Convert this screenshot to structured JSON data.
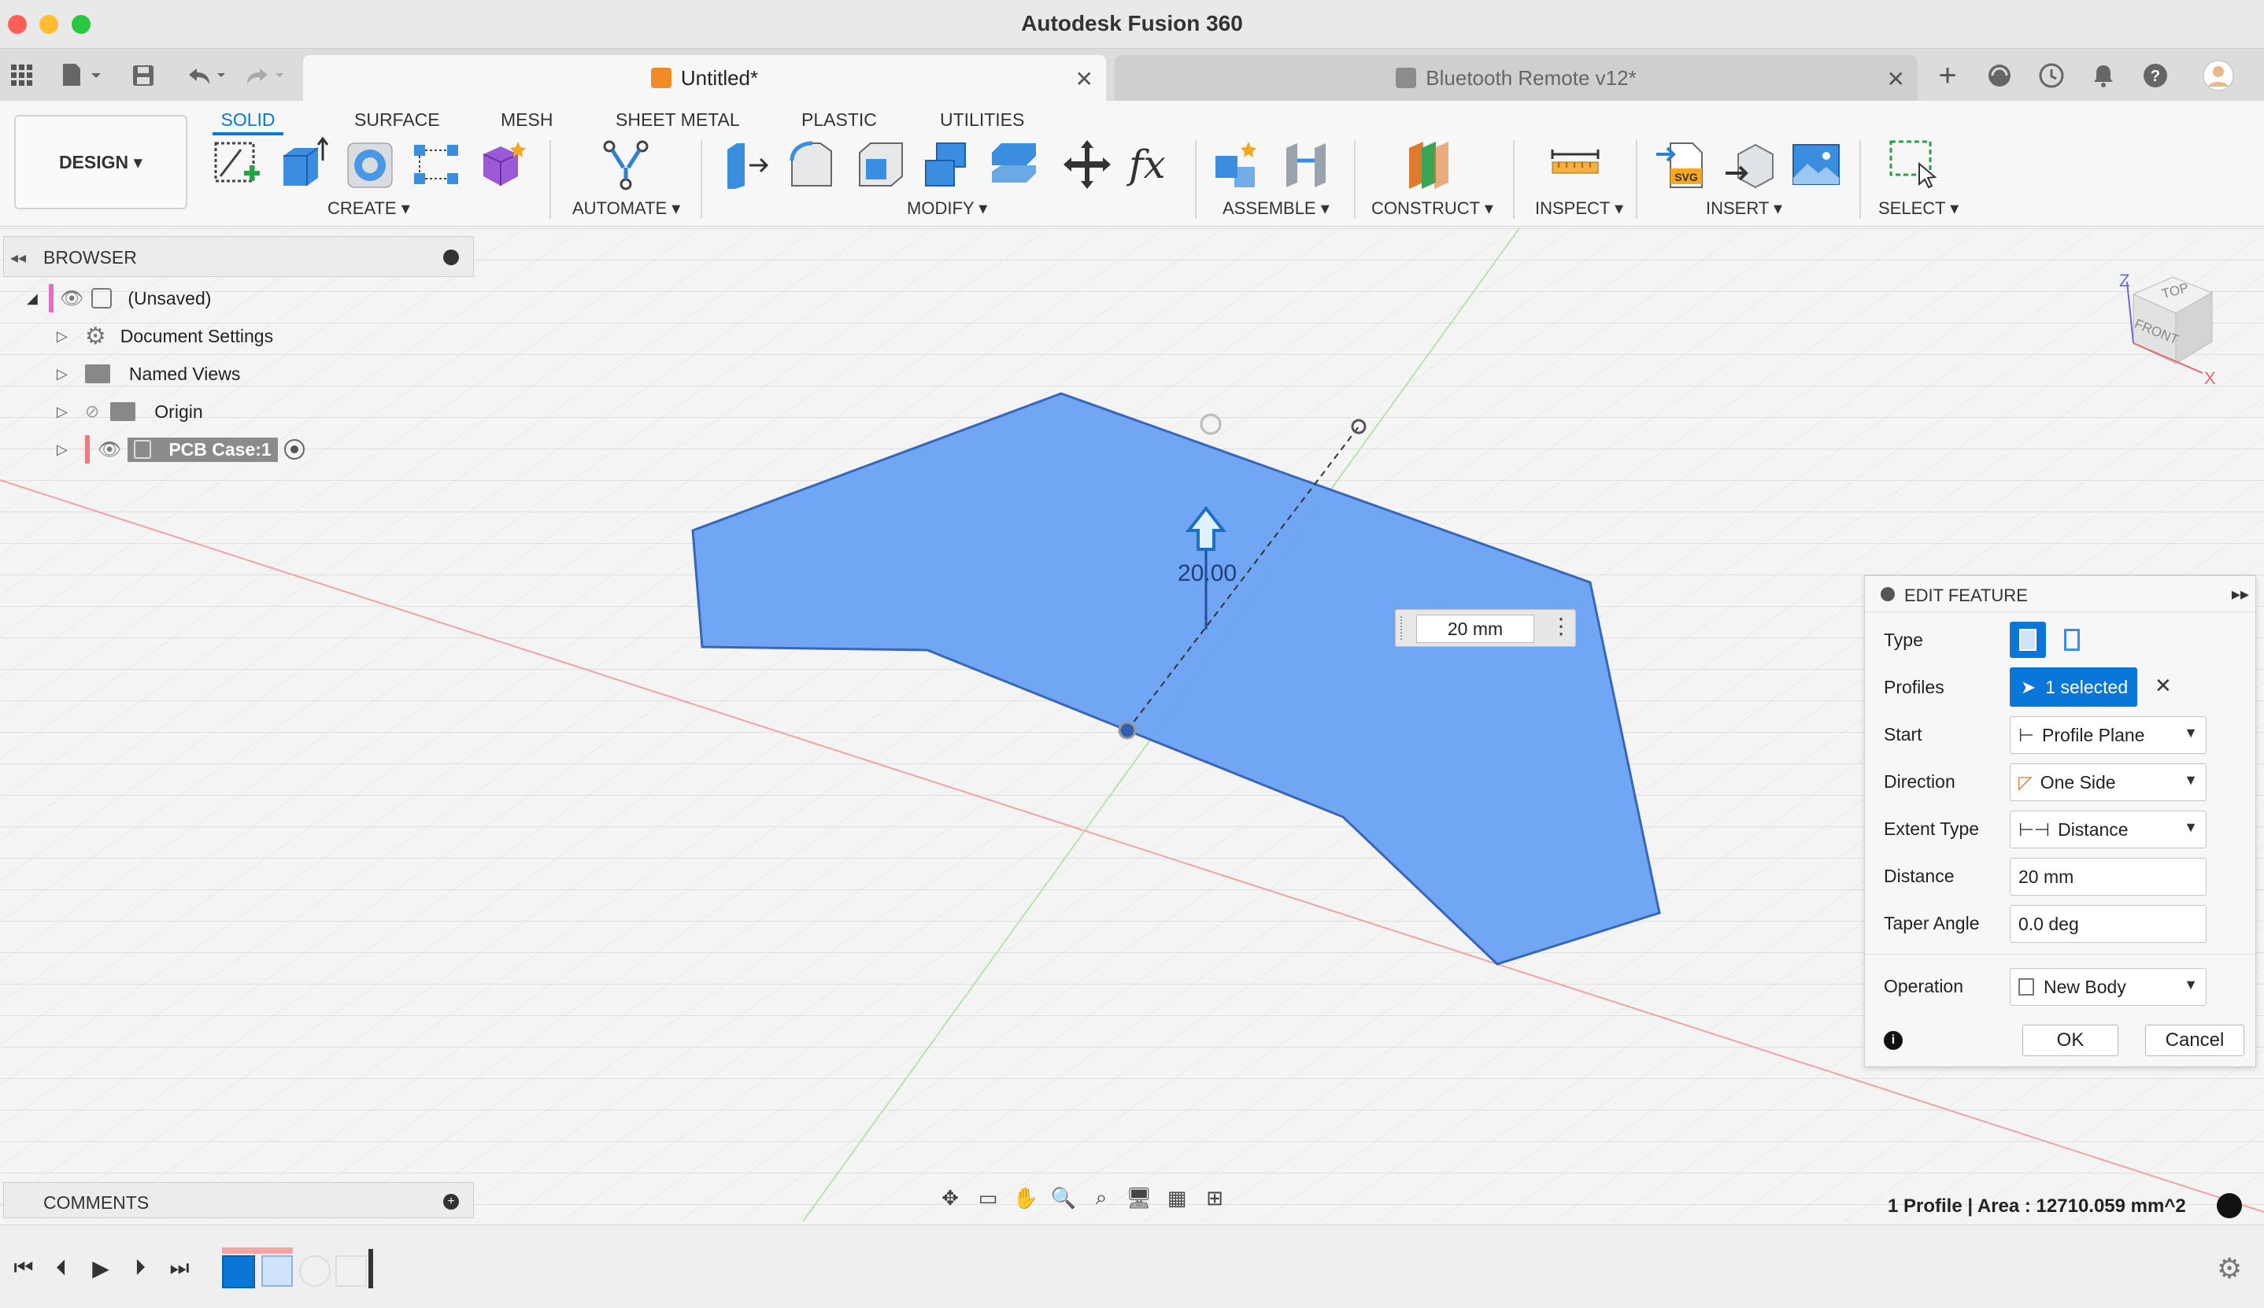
{
  "window": {
    "title": "Autodesk Fusion 360"
  },
  "tabs": [
    {
      "label": "Untitled*"
    },
    {
      "label": "Bluetooth Remote v12*"
    }
  ],
  "toolbar": {
    "workspace_button": "DESIGN ▾",
    "workspace_tabs": [
      "SOLID",
      "SURFACE",
      "MESH",
      "SHEET METAL",
      "PLASTIC",
      "UTILITIES"
    ],
    "groups": {
      "create": "CREATE ▾",
      "automate": "AUTOMATE ▾",
      "modify": "MODIFY ▾",
      "assemble": "ASSEMBLE ▾",
      "construct": "CONSTRUCT ▾",
      "inspect": "INSPECT ▾",
      "insert": "INSERT ▾",
      "select": "SELECT ▾"
    }
  },
  "browser": {
    "title": "BROWSER",
    "root": "(Unsaved)",
    "items": [
      "Document Settings",
      "Named Views",
      "Origin",
      "PCB Case:1"
    ]
  },
  "viewport": {
    "dimension_label": "20.00",
    "distance_input": "20 mm",
    "viewcube": {
      "top": "TOP",
      "front": "FRONT",
      "axis_z": "Z",
      "axis_x": "X"
    }
  },
  "edit_feature": {
    "title": "EDIT FEATURE",
    "rows": {
      "type": "Type",
      "profiles": "Profiles",
      "profiles_value": "1 selected",
      "start": "Start",
      "start_value": "Profile Plane",
      "direction": "Direction",
      "direction_value": "One Side",
      "extent_type": "Extent Type",
      "extent_type_value": "Distance",
      "distance": "Distance",
      "distance_value": "20 mm",
      "taper_angle": "Taper Angle",
      "taper_angle_value": "0.0 deg",
      "operation": "Operation",
      "operation_value": "New Body"
    },
    "ok": "OK",
    "cancel": "Cancel"
  },
  "comments": {
    "title": "COMMENTS"
  },
  "status": {
    "text": "1 Profile | Area : 12710.059 mm^2"
  },
  "colors": {
    "accent": "#0a76d8",
    "profile_fill": "#6aa2f5",
    "profile_edge": "#2f5fb5",
    "traffic_red": "#fe5f57",
    "traffic_yellow": "#febc2e",
    "traffic_green": "#28c840"
  }
}
